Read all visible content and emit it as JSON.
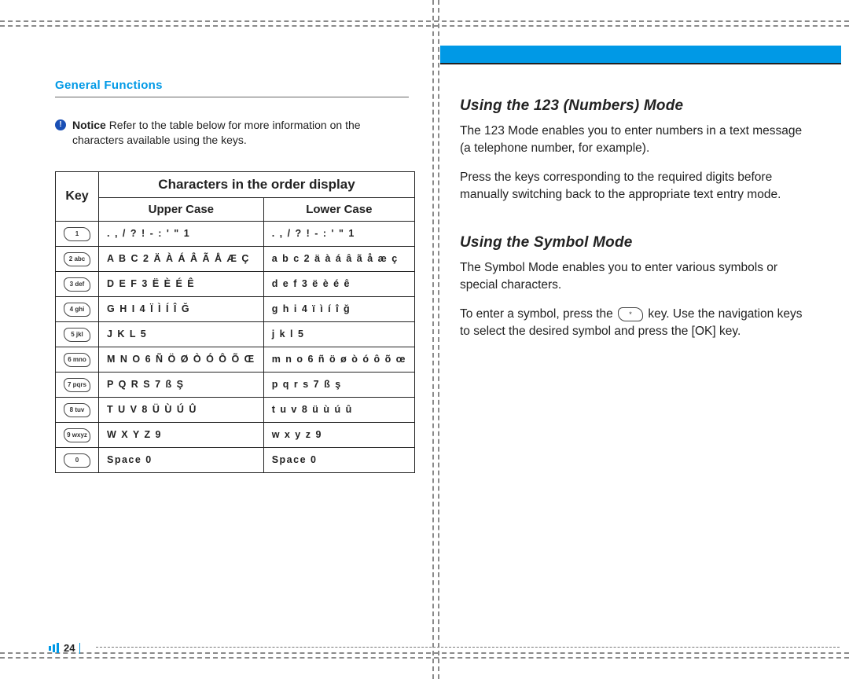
{
  "section_header": "General Functions",
  "notice": {
    "label": "Notice",
    "text": "Refer to the table below for more information on the characters available using the keys."
  },
  "table": {
    "key_header": "Key",
    "main_header": "Characters in the order display",
    "col_upper": "Upper Case",
    "col_lower": "Lower Case",
    "rows": [
      {
        "key": "1",
        "upper": ". , / ? ! - : ' \" 1",
        "lower": ". , / ? ! - : ' \" 1"
      },
      {
        "key": "2 abc",
        "upper": "A B C 2 Ä À Á Â Ã Å Æ Ç",
        "lower": "a b c 2 ä à á â ã å æ ç"
      },
      {
        "key": "3 def",
        "upper": "D E F 3 Ë È É Ê",
        "lower": "d e f 3 ë è é ê"
      },
      {
        "key": "4 ghi",
        "upper": "G H I 4 Ï Ì Í Î Ğ",
        "lower": "g h i 4 ï ì í î ğ"
      },
      {
        "key": "5 jkl",
        "upper": "J K L 5",
        "lower": "j k l 5"
      },
      {
        "key": "6 mno",
        "upper": "M N O 6 Ñ Ö Ø Ò Ó Ô Õ Œ",
        "lower": "m n o 6 ñ ö ø ò ó ô õ œ"
      },
      {
        "key": "7 pqrs",
        "upper": "P Q R S 7 ß Ş",
        "lower": "p q r s 7 ß ş"
      },
      {
        "key": "8 tuv",
        "upper": "T U V 8 Ü Ù Ú Û",
        "lower": "t u v 8 ü ù ú û"
      },
      {
        "key": "9 wxyz",
        "upper": "W X Y Z 9",
        "lower": "w x y z 9"
      },
      {
        "key": "0",
        "upper": "Space 0",
        "lower": "Space 0"
      }
    ]
  },
  "right": {
    "h1": "Using the 123 (Numbers) Mode",
    "p1": "The 123 Mode enables you to enter numbers in a text message (a telephone number, for example).",
    "p2": "Press the keys corresponding to the required digits before manually switching back to the appropriate text entry mode.",
    "h2": "Using the Symbol Mode",
    "p3": "The Symbol Mode enables you to enter various symbols or special characters.",
    "p4a": "To enter a symbol, press the ",
    "p4_key": "*",
    "p4b": " key. Use the navigation keys to select the desired symbol and press the [OK] key."
  },
  "page_number": "24"
}
